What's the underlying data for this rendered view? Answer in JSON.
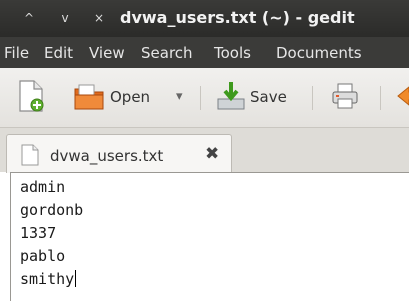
{
  "window": {
    "title": "dvwa_users.txt (~) - gedit",
    "buttons": {
      "up": "^",
      "down": "v",
      "close": "×"
    }
  },
  "menu": [
    "File",
    "Edit",
    "View",
    "Search",
    "Tools",
    "Documents"
  ],
  "toolbar": {
    "open_label": "Open",
    "save_label": "Save",
    "dropdown_glyph": "▾"
  },
  "tab": {
    "label": "dvwa_users.txt",
    "close_glyph": "✖"
  },
  "editor": {
    "lines": [
      "admin",
      "gordonb",
      "1337",
      "pablo",
      "smithy"
    ]
  }
}
